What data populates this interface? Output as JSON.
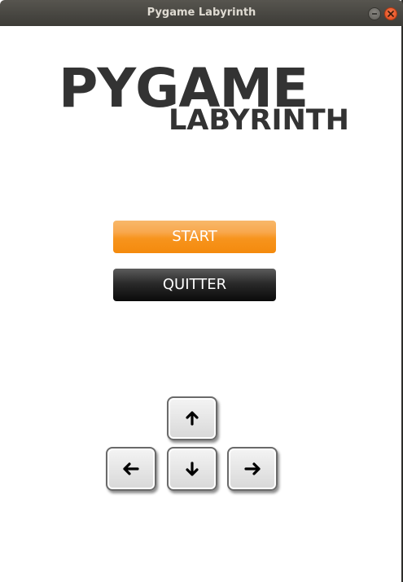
{
  "window": {
    "title": "Pygame Labyrinth"
  },
  "logo": {
    "main": "PYGAME",
    "sub": "LABYRINTH"
  },
  "menu": {
    "start_label": "START",
    "quit_label": "QUITTER"
  },
  "controls": {
    "keys": [
      "up-arrow-icon",
      "left-arrow-icon",
      "down-arrow-icon",
      "right-arrow-icon"
    ]
  },
  "colors": {
    "start_button": "#f7941d",
    "quit_button": "#111111",
    "logo_text": "#333333",
    "titlebar": "#3c3b37",
    "close_button": "#e0461a"
  }
}
